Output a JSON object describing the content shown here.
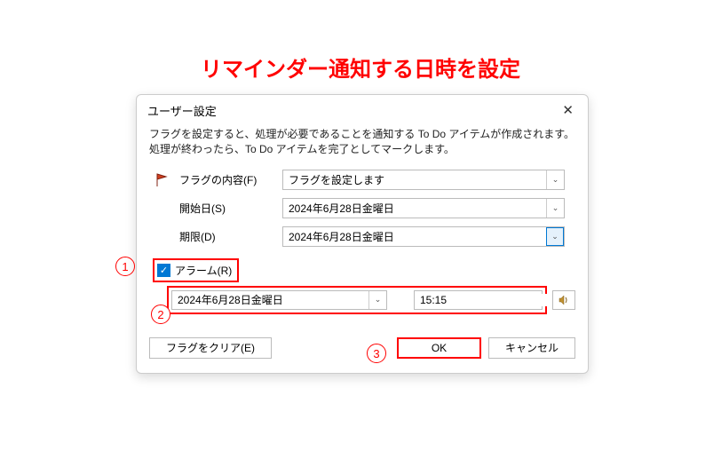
{
  "annotation": {
    "title": "リマインダー通知する日時を設定",
    "marker1": "1",
    "marker2": "2",
    "marker3": "3"
  },
  "dialog": {
    "title": "ユーザー設定",
    "description": "フラグを設定すると、処理が必要であることを通知する To Do アイテムが作成されます。処理が終わったら、To Do アイテムを完了としてマークします。",
    "labels": {
      "flagContent": "フラグの内容(F)",
      "startDate": "開始日(S)",
      "dueDate": "期限(D)",
      "alarm": "アラーム(R)"
    },
    "values": {
      "flagContent": "フラグを設定します",
      "startDate": "2024年6月28日金曜日",
      "dueDate": "2024年6月28日金曜日",
      "alarmDate": "2024年6月28日金曜日",
      "alarmTime": "15:15"
    },
    "buttons": {
      "clearFlag": "フラグをクリア(E)",
      "ok": "OK",
      "cancel": "キャンセル"
    },
    "icons": {
      "close": "✕",
      "chevronDown": "⌄",
      "check": "✓",
      "sound": "🔔"
    }
  }
}
